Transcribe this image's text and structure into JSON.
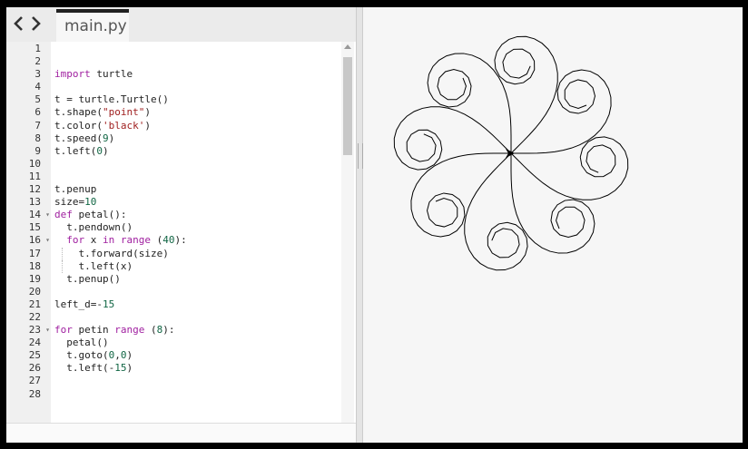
{
  "editor": {
    "tab_label": "main.py",
    "lines": [
      {
        "n": "1",
        "t": ""
      },
      {
        "n": "2",
        "t": ""
      },
      {
        "n": "3",
        "t": "import turtle"
      },
      {
        "n": "4",
        "t": ""
      },
      {
        "n": "5",
        "t": "t = turtle.Turtle()"
      },
      {
        "n": "6",
        "t": "t.shape(\"point\")"
      },
      {
        "n": "7",
        "t": "t.color('black')"
      },
      {
        "n": "8",
        "t": "t.speed(9)"
      },
      {
        "n": "9",
        "t": "t.left(0)"
      },
      {
        "n": "10",
        "t": ""
      },
      {
        "n": "11",
        "t": ""
      },
      {
        "n": "12",
        "t": "t.penup"
      },
      {
        "n": "13",
        "t": "size=10"
      },
      {
        "n": "14",
        "t": "def petal():",
        "fold": true
      },
      {
        "n": "15",
        "t": "  t.pendown()"
      },
      {
        "n": "16",
        "t": "  for x in range (40):",
        "fold": true
      },
      {
        "n": "17",
        "t": "    t.forward(size)"
      },
      {
        "n": "18",
        "t": "    t.left(x)"
      },
      {
        "n": "19",
        "t": "  t.penup()"
      },
      {
        "n": "20",
        "t": ""
      },
      {
        "n": "21",
        "t": "left_d=-15"
      },
      {
        "n": "22",
        "t": ""
      },
      {
        "n": "23",
        "t": "for petin range (8):",
        "fold": true
      },
      {
        "n": "24",
        "t": "  petal()"
      },
      {
        "n": "25",
        "t": "  t.goto(0,0)"
      },
      {
        "n": "26",
        "t": "  t.left(-15)"
      },
      {
        "n": "27",
        "t": ""
      },
      {
        "n": "28",
        "t": ""
      }
    ]
  },
  "icons": {
    "back": "chevron-left-icon",
    "forward": "chevron-right-icon"
  },
  "colors": {
    "keyword": "#a020a0",
    "string": "#a02020",
    "number": "#116644",
    "turtle_stroke": "#000000"
  },
  "turtle_program": {
    "petals": 8,
    "steps_per_petal": 40,
    "step_size": 10,
    "turn_after_petal": -15
  }
}
